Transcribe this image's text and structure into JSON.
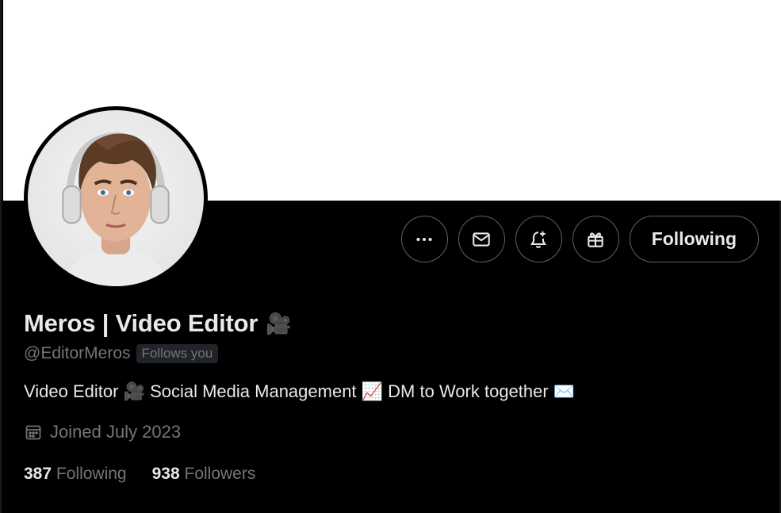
{
  "profile": {
    "display_name": "Meros | Video Editor",
    "name_emoji": "🎥",
    "handle": "@EditorMeros",
    "follows_you": "Follows you",
    "bio": "Video Editor 🎥 Social Media Management 📈 DM to Work together ✉️",
    "joined": "Joined July 2023"
  },
  "actions": {
    "more_icon": "more-horizontal-icon",
    "message_icon": "mail-icon",
    "notify_icon": "bell-plus-icon",
    "gift_icon": "gift-icon",
    "following_label": "Following"
  },
  "stats": {
    "following_count": "387",
    "following_label": "Following",
    "followers_count": "938",
    "followers_label": "Followers"
  },
  "colors": {
    "background": "#000000",
    "banner": "#ffffff",
    "text_primary": "#e7e9ea",
    "text_secondary": "#71767b",
    "button_border": "#536471"
  }
}
